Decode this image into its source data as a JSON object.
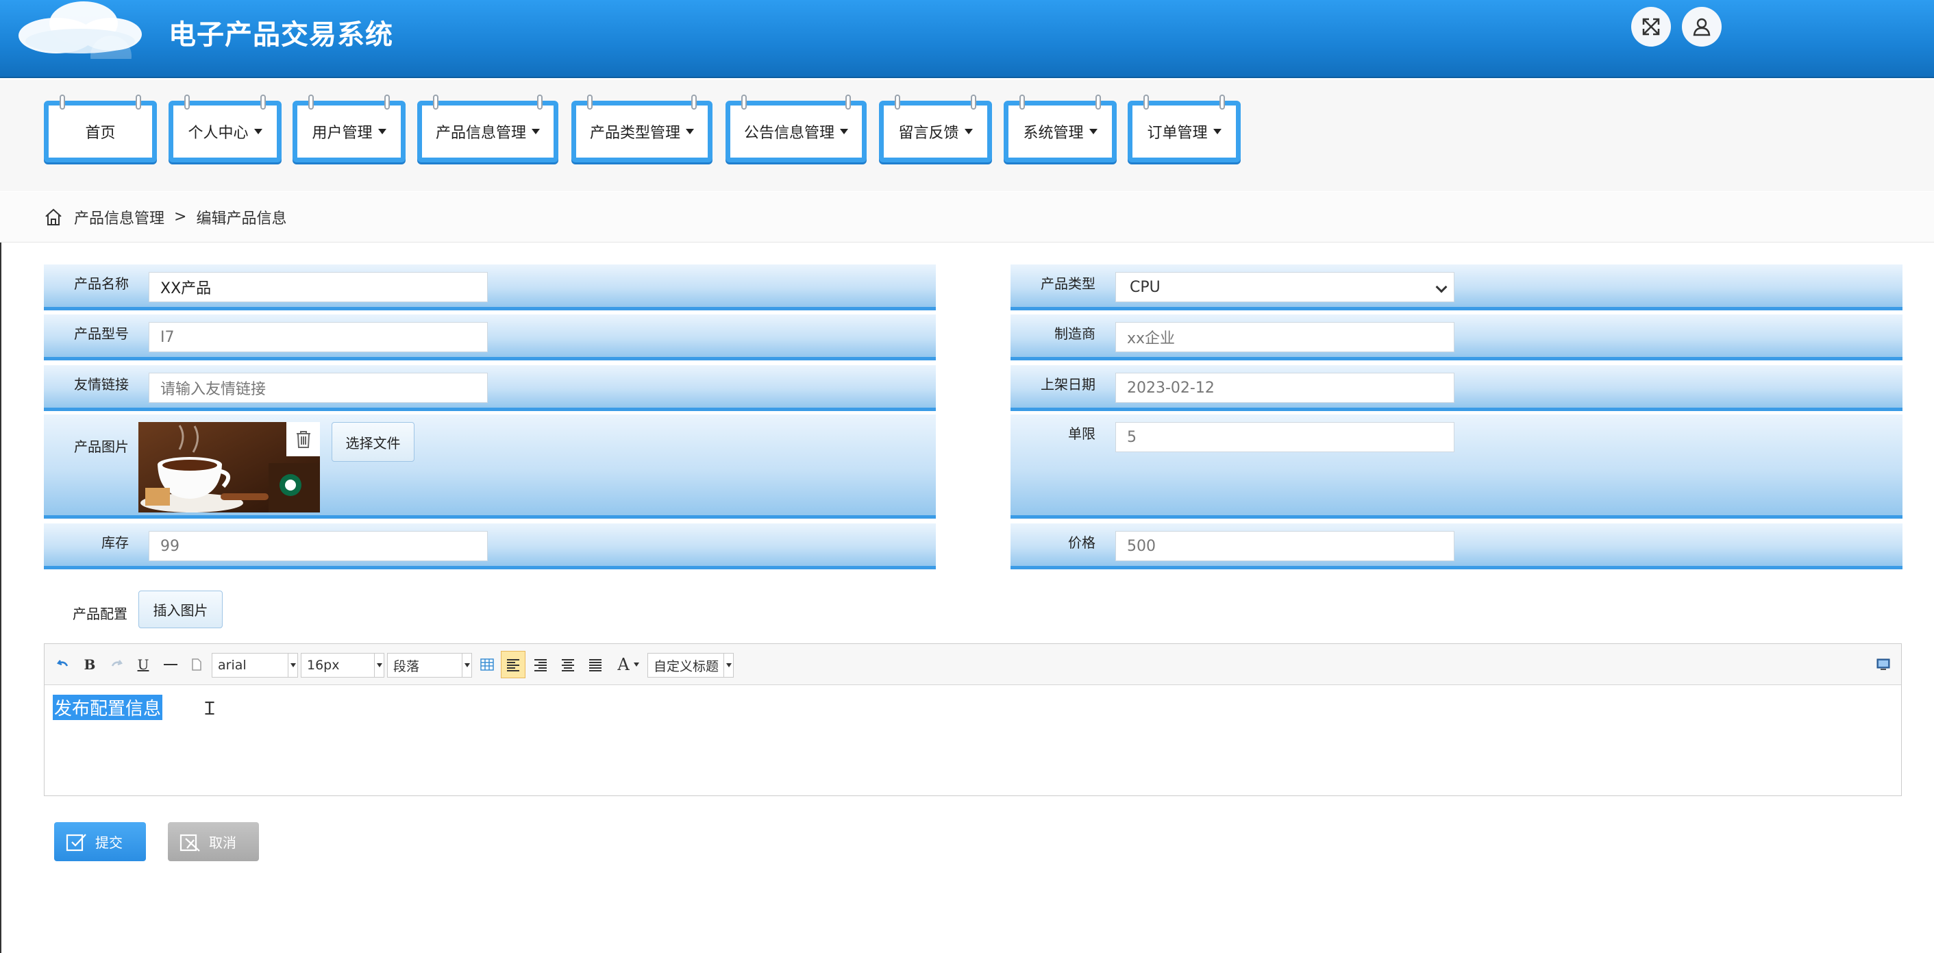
{
  "header": {
    "title": "电子产品交易系统",
    "fullscreen_icon": "fullscreen-icon",
    "user_icon": "user-icon"
  },
  "nav": {
    "items": [
      {
        "label": "首页",
        "has_caret": false
      },
      {
        "label": "个人中心",
        "has_caret": true
      },
      {
        "label": "用户管理",
        "has_caret": true
      },
      {
        "label": "产品信息管理",
        "has_caret": true
      },
      {
        "label": "产品类型管理",
        "has_caret": true
      },
      {
        "label": "公告信息管理",
        "has_caret": true
      },
      {
        "label": "留言反馈",
        "has_caret": true
      },
      {
        "label": "系统管理",
        "has_caret": true
      },
      {
        "label": "订单管理",
        "has_caret": true
      }
    ]
  },
  "breadcrumb": {
    "home_icon": "home-icon",
    "parent": "产品信息管理",
    "separator": ">",
    "current": "编辑产品信息"
  },
  "form": {
    "product_name": {
      "label": "产品名称",
      "value": "XX产品"
    },
    "product_type": {
      "label": "产品类型",
      "value": "CPU"
    },
    "product_model": {
      "label": "产品型号",
      "value": "I7"
    },
    "manufacturer": {
      "label": "制造商",
      "value": "xx企业"
    },
    "friend_link": {
      "label": "友情链接",
      "placeholder": "请输入友情链接"
    },
    "listing_date": {
      "label": "上架日期",
      "value": "2023-02-12"
    },
    "product_image": {
      "label": "产品图片",
      "choose_file_label": "选择文件"
    },
    "order_limit": {
      "label": "单限",
      "value": "5"
    },
    "stock": {
      "label": "库存",
      "value": "99"
    },
    "price": {
      "label": "价格",
      "value": "500"
    },
    "config": {
      "label": "产品配置",
      "insert_image_label": "插入图片"
    }
  },
  "editor": {
    "font_family": "arial",
    "font_size": "16px",
    "paragraph": "段落",
    "custom_heading": "自定义标题",
    "content": "发布配置信息"
  },
  "actions": {
    "submit_label": "提交",
    "cancel_label": "取消"
  },
  "colors": {
    "header_blue": "#1a82d6",
    "nav_border": "#3aa2ee",
    "submit_bg": "#3c9ef0",
    "cancel_bg": "#b5b5b5",
    "selection": "#3297f0"
  }
}
